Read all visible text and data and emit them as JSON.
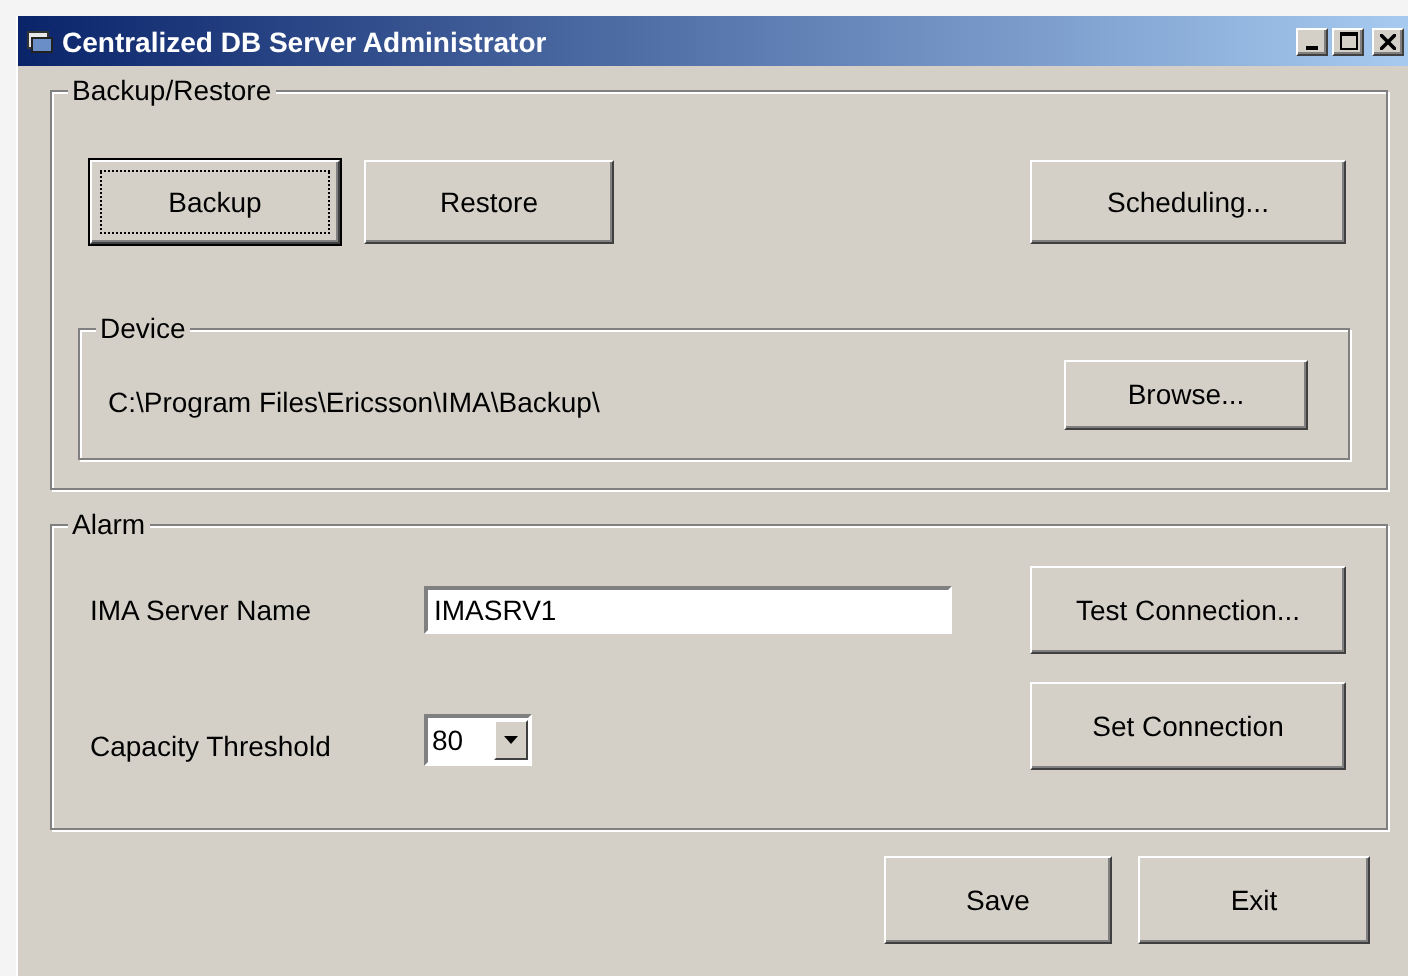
{
  "window": {
    "title": "Centralized DB Server Administrator"
  },
  "backup_restore": {
    "legend": "Backup/Restore",
    "buttons": [
      {
        "label": "Backup",
        "focused": true
      },
      {
        "label": "Restore",
        "focused": false
      },
      {
        "label": "Scheduling...",
        "focused": false
      }
    ],
    "device": {
      "legend": "Device",
      "path": "C:\\Program Files\\Ericsson\\IMA\\Backup\\",
      "button": "Browse..."
    }
  },
  "alarm": {
    "legend": "Alarm",
    "server_name": {
      "label": "IMA Server Name",
      "value": "IMASRV1"
    },
    "capacity_threshold": {
      "label": "Capacity Threshold",
      "value": "80"
    },
    "buttons": [
      "Test Connection...",
      "Set Connection"
    ]
  },
  "footer_buttons": [
    "Save",
    "Exit"
  ]
}
